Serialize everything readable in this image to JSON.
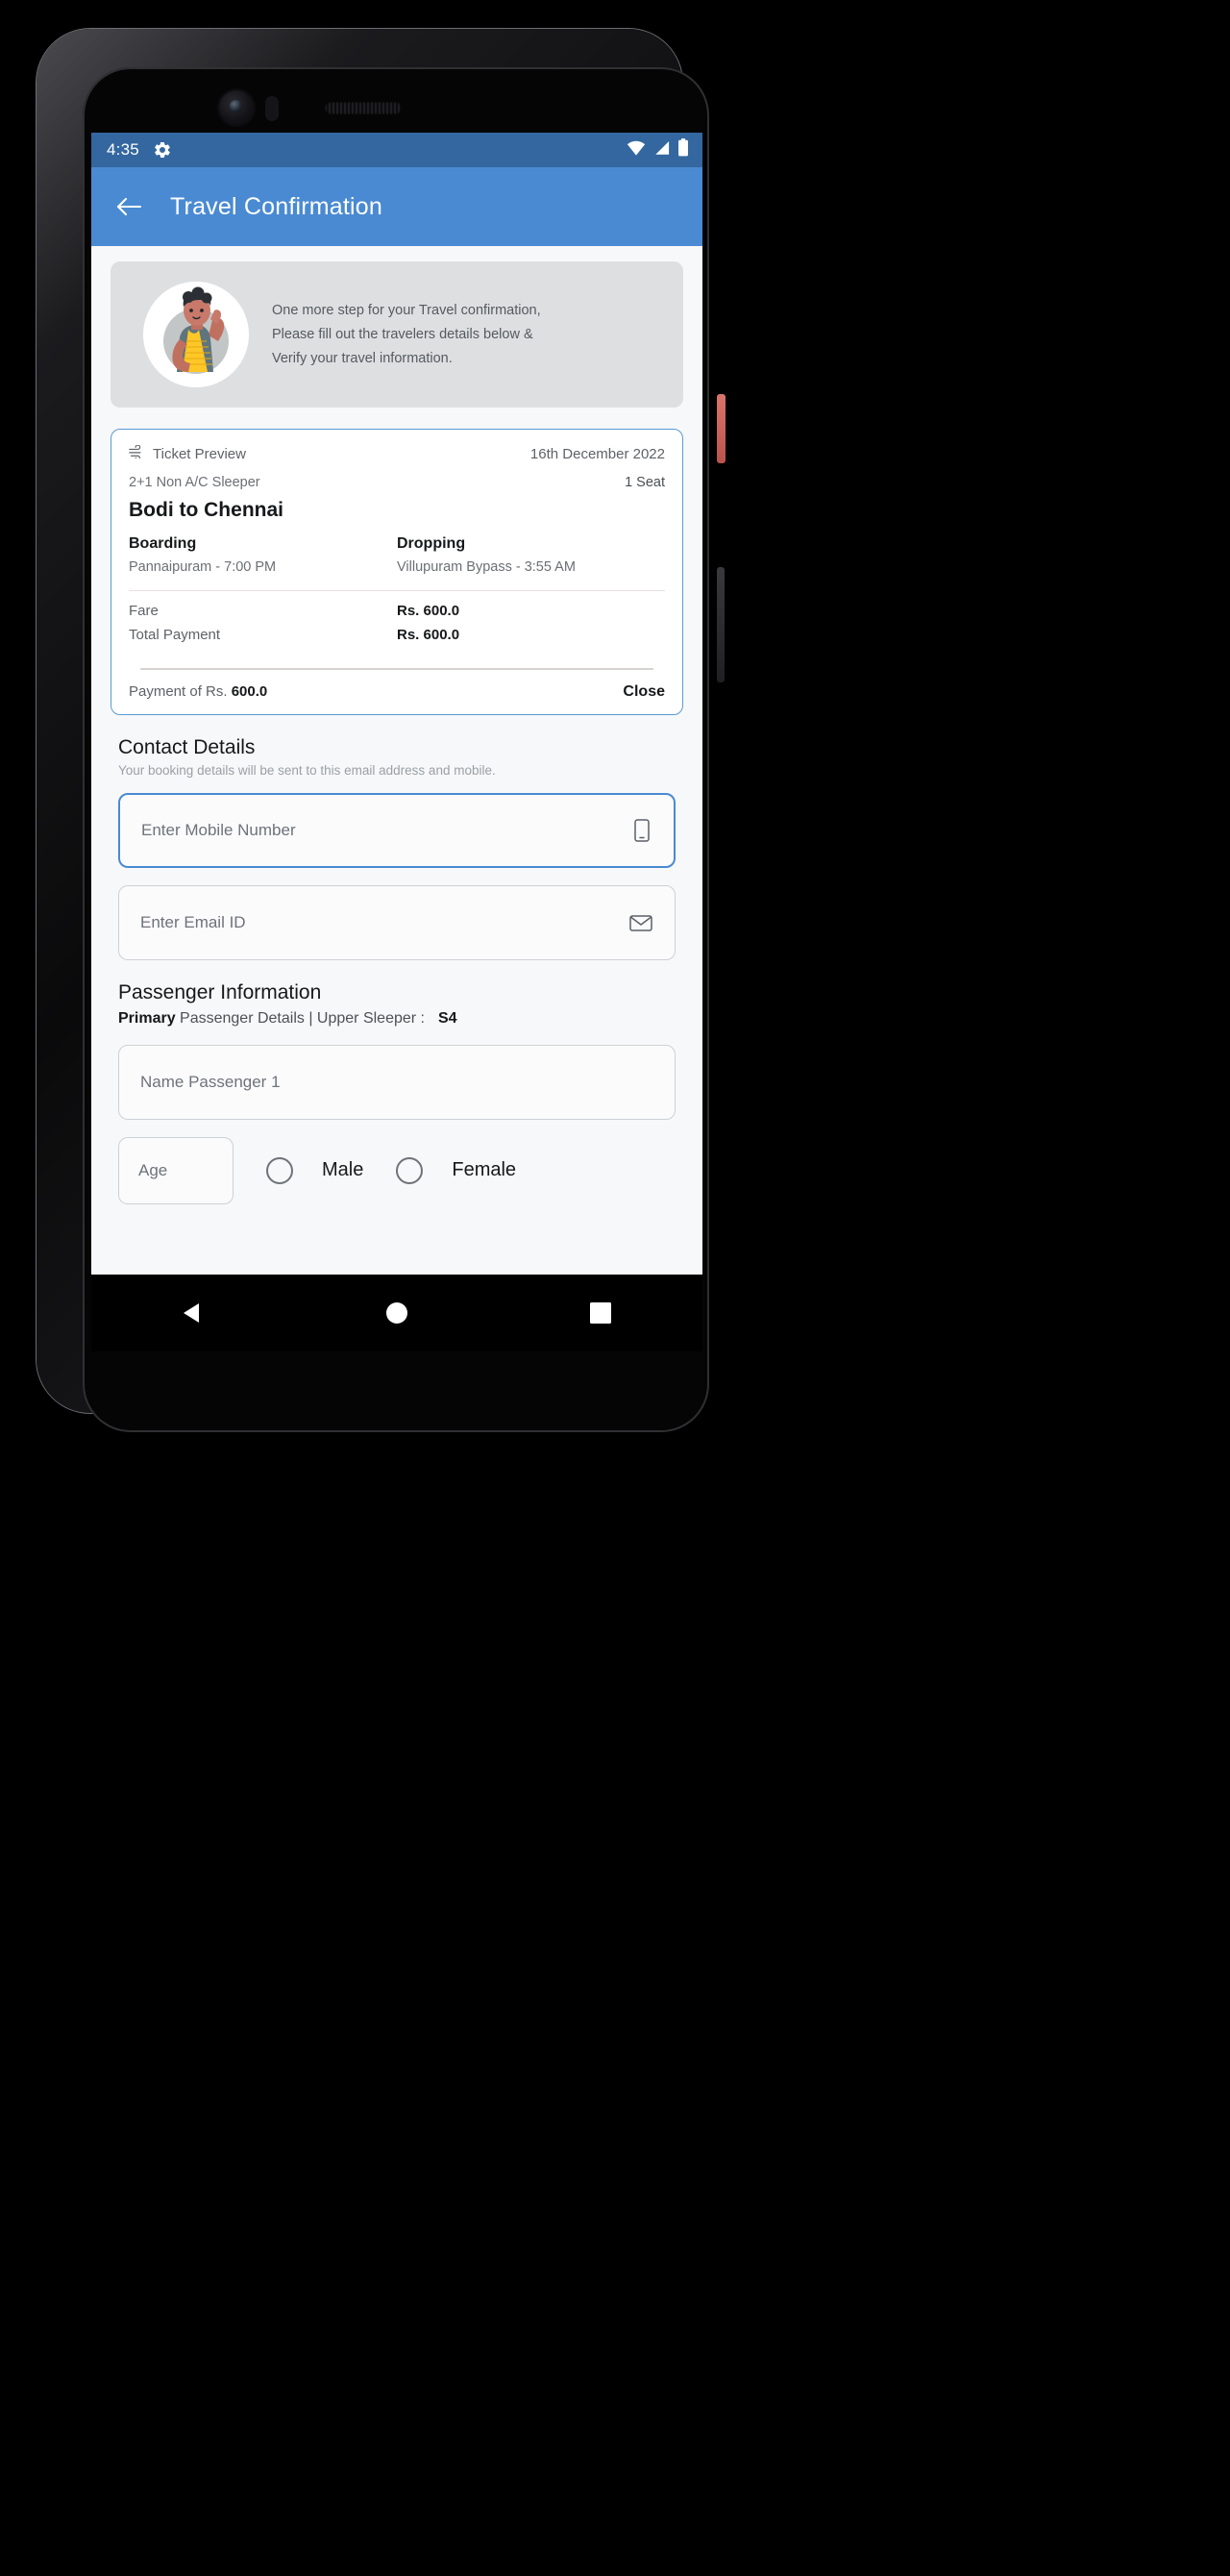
{
  "status_bar": {
    "time": "4:35",
    "icons": [
      "gear-icon",
      "wifi-icon",
      "signal-icon",
      "battery-icon"
    ]
  },
  "app_bar": {
    "back_icon": "back-arrow-icon",
    "title": "Travel Confirmation"
  },
  "banner": {
    "avatar_icon": "waving-person-illustration",
    "line1": "One more step for your Travel confirmation,",
    "line2": "Please fill out the travelers details below &",
    "line3": "Verify your travel information."
  },
  "ticket": {
    "preview_icon": "wind-icon",
    "preview_label": "Ticket Preview",
    "date": "16th December 2022",
    "coach_type": "2+1 Non A/C Sleeper",
    "seat_count": "1 Seat",
    "route": "Bodi to Chennai",
    "boarding_head": "Boarding",
    "boarding_value": "Pannaipuram - 7:00 PM",
    "dropping_head": "Dropping",
    "dropping_value": "Villupuram Bypass - 3:55 AM",
    "fare_label": "Fare",
    "fare_value": "Rs. 600.0",
    "total_label": "Total Payment",
    "total_value": "Rs. 600.0",
    "payment_prefix": "Payment of Rs. ",
    "payment_amount": "600.0",
    "close_label": "Close"
  },
  "contact": {
    "title": "Contact Details",
    "subtitle": "Your booking details will be sent to this email address and mobile.",
    "mobile_placeholder": "Enter Mobile Number",
    "mobile_icon": "mobile-phone-icon",
    "mobile_value": "",
    "email_placeholder": "Enter Email ID",
    "email_icon": "envelope-icon",
    "email_value": ""
  },
  "passenger": {
    "title": "Passenger Information",
    "primary_label": "Primary",
    "details_text": " Passenger Details | Upper Sleeper :",
    "seat": "S4",
    "name_placeholder": "Name Passenger 1",
    "name_value": "",
    "age_placeholder": "Age",
    "age_value": "",
    "male_label": "Male",
    "female_label": "Female"
  },
  "nav_bar": {
    "back_icon": "nav-back-triangle-icon",
    "home_icon": "nav-home-circle-icon",
    "recents_icon": "nav-recents-square-icon"
  },
  "colors": {
    "status_bar": "#34679f",
    "app_bar": "#4a8ad2",
    "accent": "#4a8ad2",
    "page_bg": "#f7f8f9",
    "banner_bg": "#dedfe1"
  }
}
